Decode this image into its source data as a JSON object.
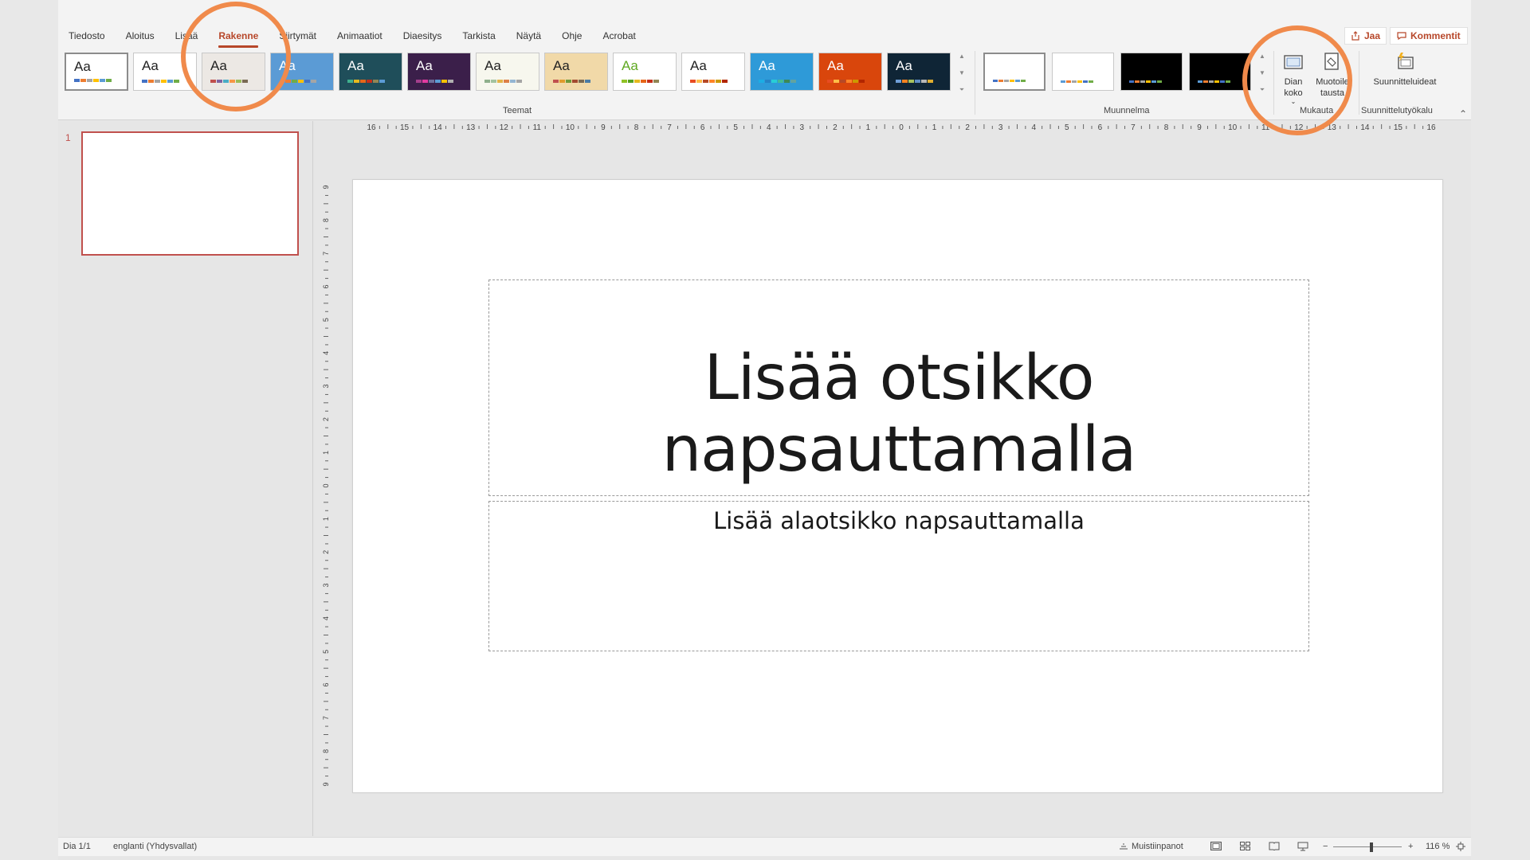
{
  "tabs": [
    "Tiedosto",
    "Aloitus",
    "Lisää",
    "Rakenne",
    "Siirtymät",
    "Animaatiot",
    "Diaesitys",
    "Tarkista",
    "Näytä",
    "Ohje",
    "Acrobat"
  ],
  "active_tab": "Rakenne",
  "share_label": "Jaa",
  "comments_label": "Kommentit",
  "themes": [
    {
      "aa": "Aa",
      "bg": "#ffffff",
      "fg": "#222222",
      "bars": [
        "#4472c4",
        "#ed7d31",
        "#a5a5a5",
        "#ffc000",
        "#5b9bd5",
        "#70ad47"
      ]
    },
    {
      "aa": "Aa",
      "bg": "#ffffff",
      "fg": "#222222",
      "bars": [
        "#4472c4",
        "#ed7d31",
        "#a5a5a5",
        "#ffc000",
        "#5b9bd5",
        "#70ad47"
      ]
    },
    {
      "aa": "Aa",
      "bg": "#ece8e4",
      "fg": "#222222",
      "bars": [
        "#c0504d",
        "#8064a2",
        "#4bacc6",
        "#f79646",
        "#9bbb59",
        "#7a6a53"
      ]
    },
    {
      "aa": "Aa",
      "bg": "#5b9bd5",
      "fg": "#ffffff",
      "bars": [
        "#5b9bd5",
        "#ed7d31",
        "#70ad47",
        "#ffc000",
        "#4472c4",
        "#a5a5a5"
      ]
    },
    {
      "aa": "Aa",
      "bg": "#1f4e5a",
      "fg": "#ffffff",
      "bars": [
        "#3fb08e",
        "#e6b91e",
        "#e76618",
        "#c42f1a",
        "#918655",
        "#5b9bd5"
      ]
    },
    {
      "aa": "Aa",
      "bg": "#3b1f4a",
      "fg": "#ffffff",
      "bars": [
        "#a53e8c",
        "#e23ba1",
        "#6f6f9c",
        "#5b9bd5",
        "#f8c100",
        "#b0b0b0"
      ]
    },
    {
      "aa": "Aa",
      "bg": "#f7f7ee",
      "fg": "#222222",
      "bars": [
        "#8fb08c",
        "#a3c3a0",
        "#e3b448",
        "#dd8047",
        "#94b6d2",
        "#a5a5a5"
      ]
    },
    {
      "aa": "Aa",
      "bg": "#f1d9a8",
      "fg": "#222222",
      "bars": [
        "#c0504d",
        "#e09b2d",
        "#6e9a3c",
        "#a24a2f",
        "#7a6a53",
        "#4a7ca6"
      ]
    },
    {
      "aa": "Aa",
      "bg": "#ffffff",
      "fg": "#5fa821",
      "bars": [
        "#90c226",
        "#54a021",
        "#e6b91e",
        "#e76618",
        "#c42f1a",
        "#918655"
      ]
    },
    {
      "aa": "Aa",
      "bg": "#ffffff",
      "fg": "#222222",
      "bars": [
        "#e84c22",
        "#ffbd47",
        "#b64926",
        "#ff8427",
        "#cc9900",
        "#b22600"
      ]
    },
    {
      "aa": "Aa",
      "bg": "#2e9ad8",
      "fg": "#ffffff",
      "bars": [
        "#1cade4",
        "#2683c6",
        "#27ced7",
        "#42ba97",
        "#3e8853",
        "#62a39f"
      ]
    },
    {
      "aa": "Aa",
      "bg": "#d9460c",
      "fg": "#ffffff",
      "bars": [
        "#e84c22",
        "#ffbd47",
        "#b64926",
        "#ff8427",
        "#cc9900",
        "#b22600"
      ]
    },
    {
      "aa": "Aa",
      "bg": "#0f2536",
      "fg": "#ffffff",
      "bars": [
        "#6f9fd8",
        "#f58220",
        "#a9c25d",
        "#5f8ec6",
        "#b8b8b8",
        "#e0ae2f"
      ]
    }
  ],
  "variants": [
    {
      "bg": "#ffffff",
      "bars": [
        "#4472c4",
        "#ed7d31",
        "#a5a5a5",
        "#ffc000",
        "#5b9bd5",
        "#70ad47"
      ]
    },
    {
      "bg": "#ffffff",
      "bars": [
        "#5b9bd5",
        "#ed7d31",
        "#a5a5a5",
        "#ffc000",
        "#4472c4",
        "#70ad47"
      ]
    },
    {
      "bg": "#000000",
      "bars": [
        "#4472c4",
        "#ed7d31",
        "#a5a5a5",
        "#ffc000",
        "#5b9bd5",
        "#70ad47"
      ]
    },
    {
      "bg": "#000000",
      "bars": [
        "#5b9bd5",
        "#ed7d31",
        "#a5a5a5",
        "#ffc000",
        "#4472c4",
        "#70ad47"
      ]
    }
  ],
  "groups": {
    "themes": "Teemat",
    "variants": "Muunnelma",
    "customize": "Mukauta",
    "designer": "Suunnittelutyökalu"
  },
  "buttons": {
    "slide_size": "Dian koko",
    "format_bg_line1": "Muotoile",
    "format_bg_line2": "tausta",
    "design_ideas": "Suunnitteluideat"
  },
  "slide_number": "1",
  "slide": {
    "title": "Lisää otsikko napsauttamalla",
    "subtitle": "Lisää alaotsikko napsauttamalla"
  },
  "ruler": {
    "horizontal": [
      "16",
      "15",
      "14",
      "13",
      "12",
      "11",
      "10",
      "9",
      "8",
      "7",
      "6",
      "5",
      "4",
      "3",
      "2",
      "1",
      "0",
      "1",
      "2",
      "3",
      "4",
      "5",
      "6",
      "7",
      "8",
      "9",
      "10",
      "11",
      "12",
      "13",
      "14",
      "15",
      "16"
    ],
    "vertical": [
      "9",
      "8",
      "7",
      "6",
      "5",
      "4",
      "3",
      "2",
      "1",
      "0",
      "1",
      "2",
      "3",
      "4",
      "5",
      "6",
      "7",
      "8",
      "9"
    ]
  },
  "status": {
    "slide_info": "Dia 1/1",
    "language": "englanti (Yhdysvallat)",
    "notes": "Muistiinpanot",
    "zoom": "116 %"
  },
  "colors": {
    "accent": "#b7472a",
    "annotation": "#f08a4b"
  }
}
